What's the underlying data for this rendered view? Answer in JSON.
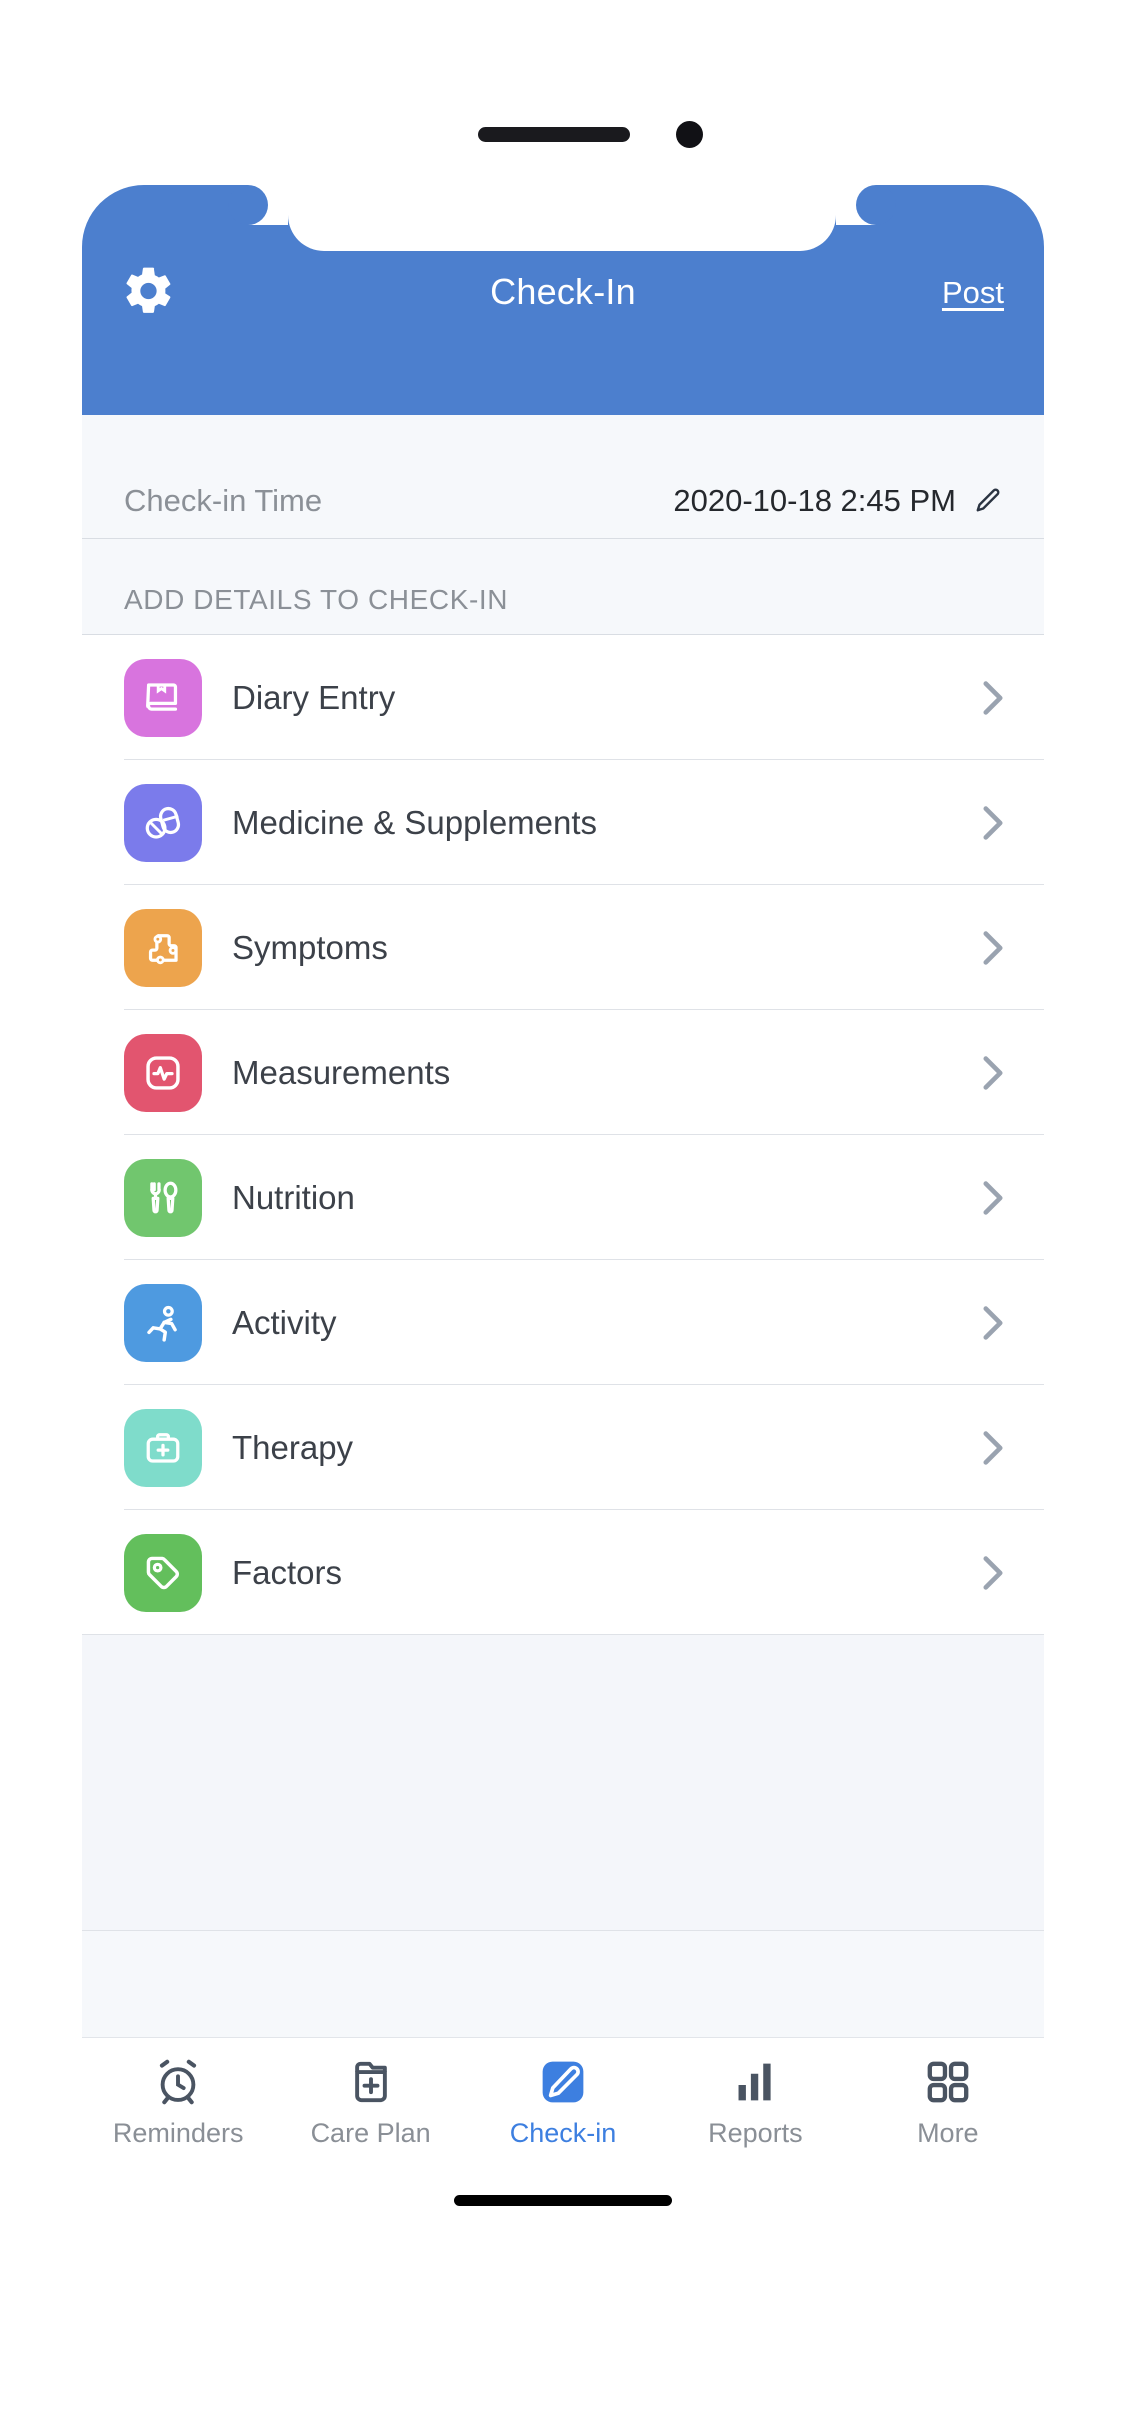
{
  "header": {
    "title": "Check-In",
    "post_label": "Post",
    "settings_icon": "gear-icon",
    "bg_color": "#4c7fce"
  },
  "time_row": {
    "label": "Check-in Time",
    "value": "2020-10-18 2:45 PM",
    "edit_icon": "pencil-icon"
  },
  "section": {
    "header": "ADD DETAILS TO CHECK-IN"
  },
  "list": {
    "items": [
      {
        "label": "Diary Entry",
        "icon": "book-icon",
        "color": "#d874de",
        "chevron": "chevron-right-icon"
      },
      {
        "label": "Medicine & Supplements",
        "icon": "pill-icon",
        "color": "#7b7beb",
        "chevron": "chevron-right-icon"
      },
      {
        "label": "Symptoms",
        "icon": "body-icon",
        "color": "#eda champion",
        "chevron": "chevron-right-icon"
      },
      {
        "label": "Measurements",
        "icon": "pulse-icon",
        "color": "#e2556f",
        "chevron": "chevron-right-icon"
      },
      {
        "label": "Nutrition",
        "icon": "cutlery-icon",
        "color": "#71c66e",
        "chevron": "chevron-right-icon"
      },
      {
        "label": "Activity",
        "icon": "running-icon",
        "color": "#4e9ae0",
        "chevron": "chevron-right-icon"
      },
      {
        "label": "Therapy",
        "icon": "medkit-icon",
        "color": "#7fdccb",
        "chevron": "chevron-right-icon"
      },
      {
        "label": "Factors",
        "icon": "tag-icon",
        "color": "#63bf5c",
        "chevron": "chevron-right-icon"
      }
    ]
  },
  "tabbar": {
    "active_color": "#3d7fe0",
    "items": [
      {
        "label": "Reminders",
        "icon": "alarm-clock-icon",
        "active": false
      },
      {
        "label": "Care Plan",
        "icon": "medical-folder-icon",
        "active": false
      },
      {
        "label": "Check-in",
        "icon": "pencil-square-icon",
        "active": true
      },
      {
        "label": "Reports",
        "icon": "bar-chart-icon",
        "active": false
      },
      {
        "label": "More",
        "icon": "grid-icon",
        "active": false
      }
    ]
  }
}
